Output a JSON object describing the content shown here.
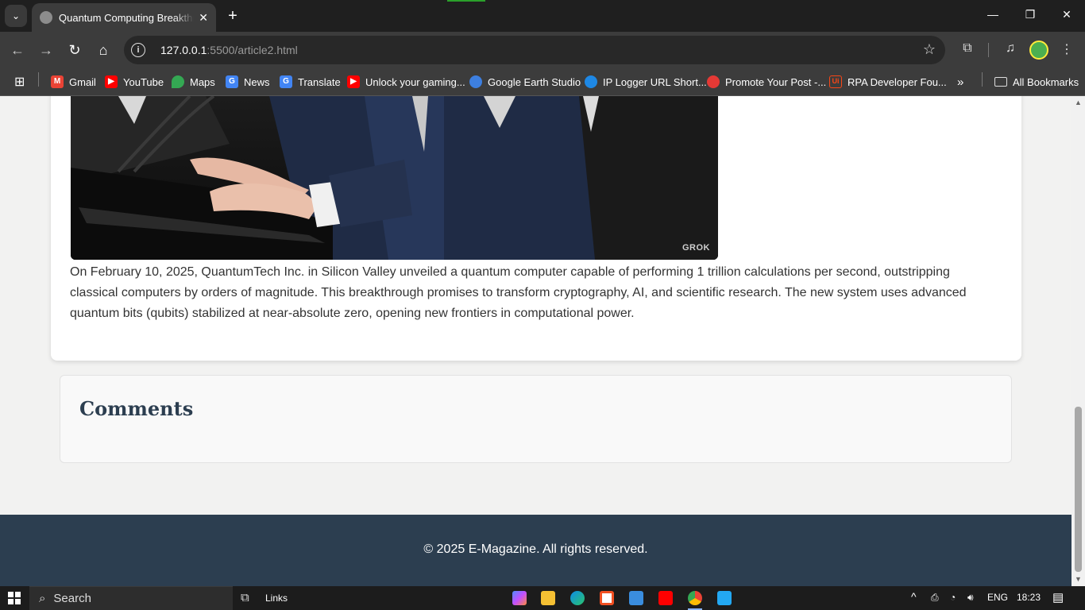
{
  "browser": {
    "tab_title": "Quantum Computing Breakthrough",
    "url_host": "127.0.0.1",
    "url_rest": ":5500/article2.html",
    "bookmarks": [
      {
        "label": "Gmail",
        "icon": "gmail-icon",
        "color": "#ea4335"
      },
      {
        "label": "YouTube",
        "icon": "youtube-icon",
        "color": "#ff0000"
      },
      {
        "label": "Maps",
        "icon": "maps-icon",
        "color": "#34a853"
      },
      {
        "label": "News",
        "icon": "news-icon",
        "color": "#4285f4"
      },
      {
        "label": "Translate",
        "icon": "translate-icon",
        "color": "#4285f4"
      },
      {
        "label": "Unlock your gaming...",
        "icon": "youtube-icon",
        "color": "#ff0000"
      },
      {
        "label": "Google Earth Studio",
        "icon": "earth-icon",
        "color": "#3d7fe0"
      },
      {
        "label": "IP Logger URL Short...",
        "icon": "ip-logger-icon",
        "color": "#1e88e5"
      },
      {
        "label": "Promote Your Post -...",
        "icon": "rocket-icon",
        "color": "#e53935"
      },
      {
        "label": "RPA Developer Fou...",
        "icon": "uipath-icon",
        "color": "#fa4616"
      }
    ],
    "all_bookmarks_label": "All Bookmarks"
  },
  "article": {
    "body": "On February 10, 2025, QuantumTech Inc. in Silicon Valley unveiled a quantum computer capable of performing 1 trillion calculations per second, outstripping classical computers by orders of magnitude. This breakthrough promises to transform cryptography, AI, and scientific research. The new system uses advanced quantum bits (qubits) stabilized at near-absolute zero, opening new frontiers in computational power.",
    "image_watermark": "GROK"
  },
  "comments": {
    "title": "Comments"
  },
  "footer": {
    "text": "© 2025 E-Magazine. All rights reserved."
  },
  "taskbar": {
    "search_label": "Search",
    "links_label": "Links",
    "language": "ENG",
    "time": "18:23"
  }
}
